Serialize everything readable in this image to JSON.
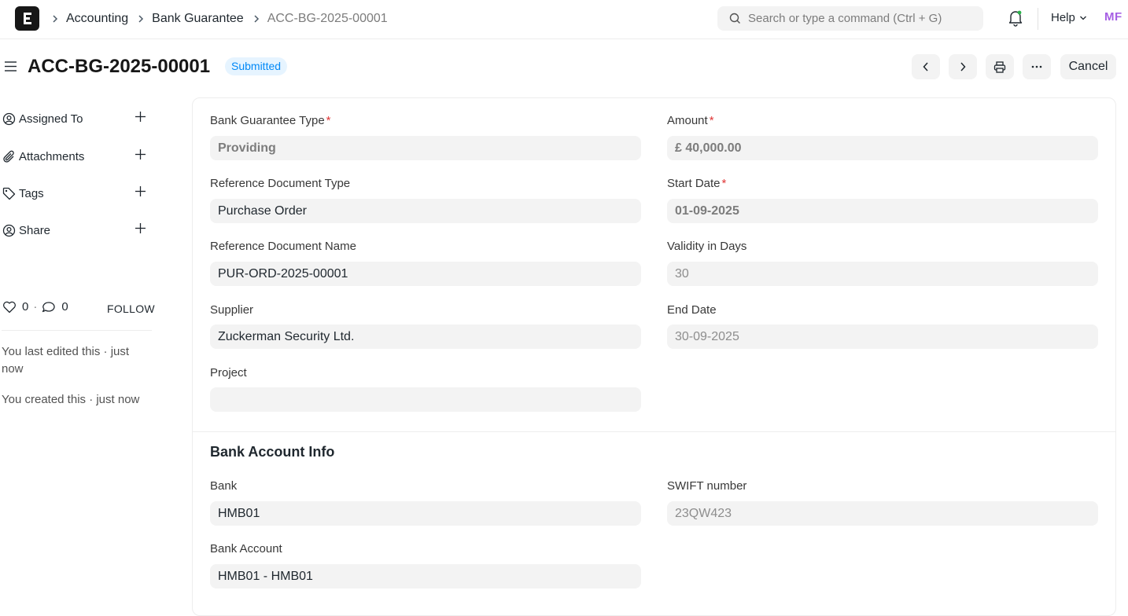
{
  "breadcrumb": {
    "items": [
      "Accounting",
      "Bank Guarantee"
    ],
    "current": "ACC-BG-2025-00001"
  },
  "search": {
    "placeholder": "Search or type a command (Ctrl + G)"
  },
  "navbar": {
    "help_label": "Help",
    "avatar_initials": "MF"
  },
  "page": {
    "title": "ACC-BG-2025-00001",
    "status": "Submitted",
    "cancel_label": "Cancel",
    "status_color": "#0289f7"
  },
  "sidebar": {
    "items": [
      {
        "label": "Assigned To",
        "icon": "user-assign-icon"
      },
      {
        "label": "Attachments",
        "icon": "paperclip-icon"
      },
      {
        "label": "Tags",
        "icon": "tag-icon"
      },
      {
        "label": "Share",
        "icon": "share-user-icon"
      }
    ],
    "likes": "0",
    "comments": "0",
    "follow_label": "FOLLOW",
    "last_edited": "You last edited this · just now",
    "created": "You created this · just now"
  },
  "form": {
    "bank_guarantee_type": {
      "label": "Bank Guarantee Type",
      "value": "Providing"
    },
    "amount": {
      "label": "Amount",
      "value": "£ 40,000.00"
    },
    "reference_document_type": {
      "label": "Reference Document Type",
      "value": "Purchase Order"
    },
    "start_date": {
      "label": "Start Date",
      "value": "01-09-2025"
    },
    "reference_document_name": {
      "label": "Reference Document Name",
      "value": "PUR-ORD-2025-00001"
    },
    "validity_in_days": {
      "label": "Validity in Days",
      "value": "30"
    },
    "supplier": {
      "label": "Supplier",
      "value": "Zuckerman Security Ltd."
    },
    "end_date": {
      "label": "End Date",
      "value": "30-09-2025"
    },
    "project": {
      "label": "Project",
      "value": ""
    },
    "bank_section_title": "Bank Account Info",
    "bank": {
      "label": "Bank",
      "value": "HMB01"
    },
    "swift_number": {
      "label": "SWIFT number",
      "value": "23QW423"
    },
    "bank_account": {
      "label": "Bank Account",
      "value": "HMB01 - HMB01"
    },
    "required_marker": "*"
  }
}
